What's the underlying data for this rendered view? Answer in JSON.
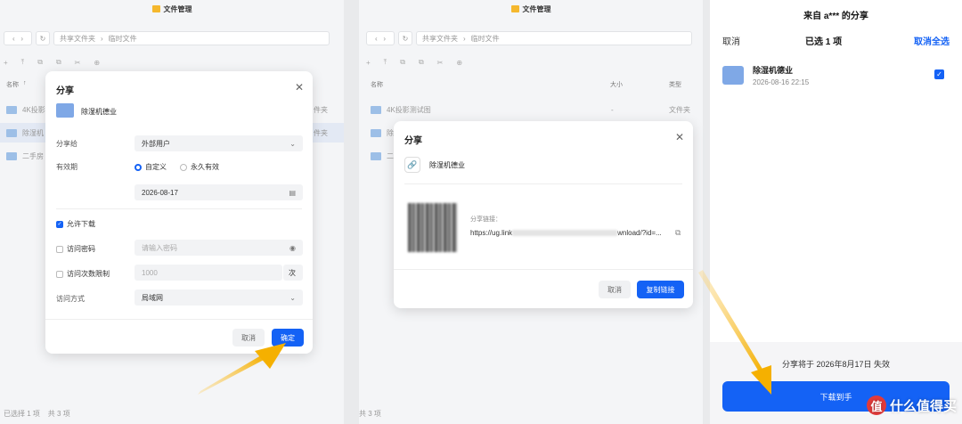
{
  "app_title": "文件管理",
  "panel1": {
    "breadcrumb": [
      "共享文件夹",
      "临时文件"
    ],
    "list_header": {
      "name": "名称"
    },
    "files": [
      "4K投影",
      "除湿机",
      "二手房"
    ],
    "file_types": [
      "件夹",
      "件夹"
    ],
    "status": {
      "selected": "已选择 1 项",
      "total": "共 3 项"
    }
  },
  "dialog1": {
    "title": "分享",
    "item_name": "除湿机德业",
    "share_to_label": "分享给",
    "share_to_value": "外部用户",
    "validity_label": "有效期",
    "validity_options": [
      "自定义",
      "永久有效"
    ],
    "date_value": "2026-08-17",
    "allow_download": "允许下载",
    "password_label": "访问密码",
    "password_placeholder": "请输入密码",
    "limit_label": "访问次数限制",
    "limit_placeholder": "1000",
    "limit_unit": "次",
    "access_label": "访问方式",
    "access_value": "局域网",
    "cancel": "取消",
    "confirm": "确定"
  },
  "panel2": {
    "breadcrumb": [
      "共享文件夹",
      "临时文件"
    ],
    "list_header": {
      "name": "名称",
      "size": "大小",
      "type": "类型"
    },
    "files": [
      "4K投影测试图",
      "除",
      "二"
    ],
    "row1_size": "-",
    "row1_type": "文件夹",
    "status": {
      "total": "共 3 项"
    }
  },
  "dialog2": {
    "title": "分享",
    "item_name": "除湿机德业",
    "link_label": "分享链接：",
    "link_prefix": "https://ug.link",
    "link_suffix": "wnload/?id=...",
    "cancel": "取消",
    "copy": "复制链接"
  },
  "mobile": {
    "title": "来自 a*** 的分享",
    "cancel": "取消",
    "selected": "已选 1 项",
    "cancel_all": "取消全选",
    "item_name": "除湿机德业",
    "item_date": "2026-08-16 22:15",
    "expire_text": "分享将于 2026年8月17日 失效",
    "download_btn": "下载到手",
    "watermark_circle": "值",
    "watermark_text": "什么值得买"
  },
  "colors": {
    "accent": "#1462f5",
    "arrow": "#f5b82e",
    "folder": "#7fa8e6"
  }
}
